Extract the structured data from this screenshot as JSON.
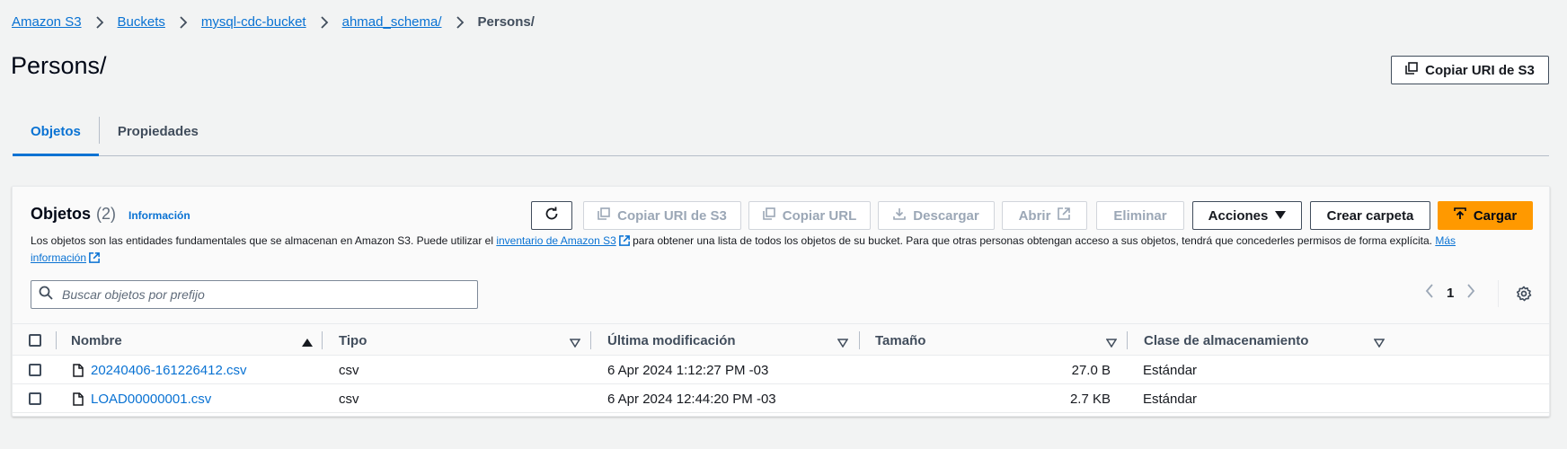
{
  "breadcrumbs": [
    "Amazon S3",
    "Buckets",
    "mysql-cdc-bucket",
    "ahmad_schema/"
  ],
  "breadcrumb_current": "Persons/",
  "page_title": "Persons/",
  "header_button": "Copiar URI de S3",
  "tabs": [
    {
      "label": "Objetos",
      "active": true
    },
    {
      "label": "Propiedades",
      "active": false
    }
  ],
  "objects_panel": {
    "title": "Objetos",
    "count": "(2)",
    "info_link": "Información",
    "description_part1": "Los objetos son las entidades fundamentales que se almacenan en Amazon S3. Puede utilizar el ",
    "description_link1": "inventario de Amazon S3",
    "description_part2": " para obtener una lista de todos los objetos de su bucket. Para que otras personas obtengan acceso a sus objetos, tendrá que concederles permisos de forma explícita. ",
    "description_link2": "Más información",
    "toolbar": {
      "copy_uri": "Copiar URI de S3",
      "copy_url": "Copiar URL",
      "download": "Descargar",
      "open": "Abrir",
      "delete": "Eliminar",
      "actions": "Acciones",
      "create_folder": "Crear carpeta",
      "upload": "Cargar"
    },
    "search_placeholder": "Buscar objetos por prefijo",
    "current_page": "1"
  },
  "table": {
    "columns": [
      "Nombre",
      "Tipo",
      "Última modificación",
      "Tamaño",
      "Clase de almacenamiento"
    ],
    "rows": [
      {
        "name": "20240406-161226412.csv",
        "type": "csv",
        "modified": "6 Apr 2024 1:12:27 PM -03",
        "size": "27.0 B",
        "storage": "Estándar"
      },
      {
        "name": "LOAD00000001.csv",
        "type": "csv",
        "modified": "6 Apr 2024 12:44:20 PM -03",
        "size": "2.7 KB",
        "storage": "Estándar"
      }
    ]
  },
  "colors": {
    "link": "#0972d3",
    "primary_button": "#ff9900",
    "background": "#f2f3f3"
  }
}
